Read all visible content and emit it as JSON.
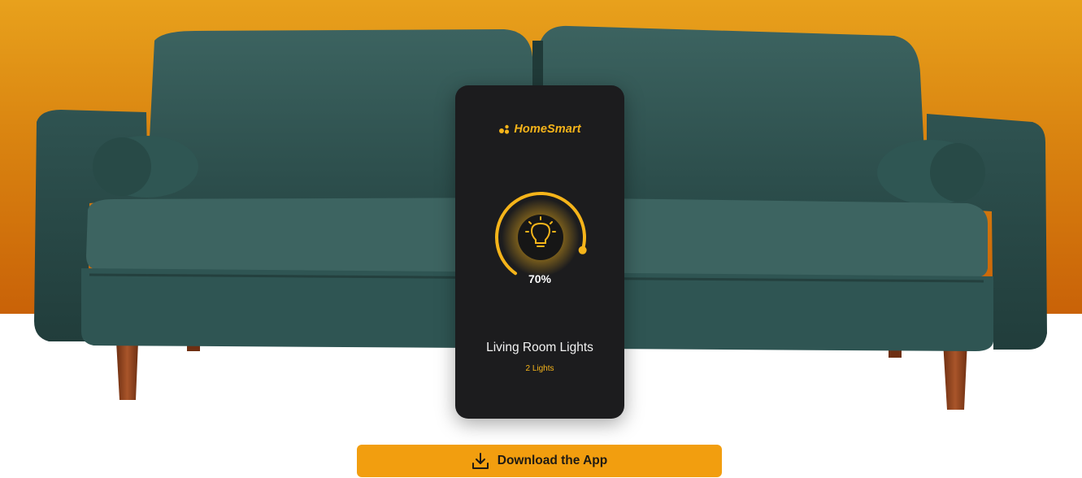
{
  "hero": {
    "image": "green-velvet-sofa-photo",
    "bg_top": "#e8a11c",
    "bg_bottom": "#c96208"
  },
  "app_card": {
    "brand": {
      "name": "HomeSmart",
      "logo_icon": "dots-logo-icon",
      "color": "#f5b41a"
    },
    "dial": {
      "icon": "lightbulb-icon",
      "level_percent": 70,
      "value_text": "70%",
      "accent": "#f5b41a"
    },
    "room": {
      "name": "Living Room Lights",
      "count_text": "2 Lights"
    }
  },
  "cta": {
    "label": "Download the App",
    "icon": "download-icon",
    "color": "#f29e0f"
  }
}
